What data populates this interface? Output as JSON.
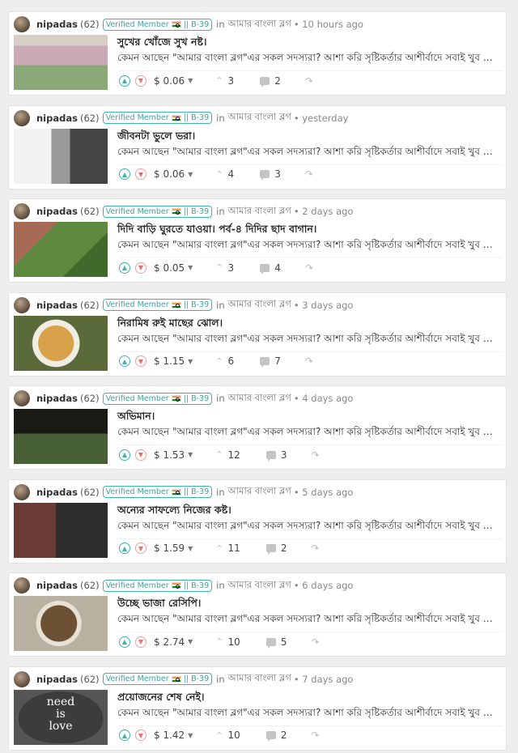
{
  "posts": [
    {
      "author": "nipadas",
      "rep": "(62)",
      "badge": "Verified Member",
      "badge_suffix": "|| B-39",
      "cat_prefix": "in",
      "category": "আমার বাংলা ব্লগ",
      "time": "• 10 hours ago",
      "title": "সুখের খোঁজে সুখ নষ্ট।",
      "excerpt": "কেমন আছেন \"আমার বাংলা ব্লগ\"এর সকল সদস্যরা? আশা করি সৃষ্টিকর্তার আশীর্বাদে সবাই খুব ভালো আছেন।",
      "payout": "$ 0.06",
      "votes": "3",
      "comments": "2"
    },
    {
      "author": "nipadas",
      "rep": "(62)",
      "badge": "Verified Member",
      "badge_suffix": "|| B-39",
      "cat_prefix": "in",
      "category": "আমার বাংলা ব্লগ",
      "time": "• yesterday",
      "title": "জীবনটা ভুলে ভরা।",
      "excerpt": "কেমন আছেন \"আমার বাংলা ব্লগ\"এর সকল সদস্যরা? আশা করি সৃষ্টিকর্তার আশীর্বাদে সবাই খুব ভালো আছেন।",
      "payout": "$ 0.06",
      "votes": "4",
      "comments": "3"
    },
    {
      "author": "nipadas",
      "rep": "(62)",
      "badge": "Verified Member",
      "badge_suffix": "|| B-39",
      "cat_prefix": "in",
      "category": "আমার বাংলা ব্লগ",
      "time": "• 2 days ago",
      "title": "দিদি বাড়ি ঘুরতে যাওয়া। পর্ব-৪ দিদির ছাদ বাগান।",
      "excerpt": "কেমন আছেন \"আমার বাংলা ব্লগ\"এর সকল সদস্যরা? আশা করি সৃষ্টিকর্তার আশীর্বাদে সবাই খুব ভালো আছেন।",
      "payout": "$ 0.05",
      "votes": "3",
      "comments": "4"
    },
    {
      "author": "nipadas",
      "rep": "(62)",
      "badge": "Verified Member",
      "badge_suffix": "|| B-39",
      "cat_prefix": "in",
      "category": "আমার বাংলা ব্লগ",
      "time": "• 3 days ago",
      "title": "নিরামিষ রুই মাছের ঝোল।",
      "excerpt": "কেমন আছেন \"আমার বাংলা ব্লগ\"এর সকল সদস্যরা? আশা করি সৃষ্টিকর্তার আশীর্বাদে সবাই খুব ভালো আছেন।",
      "payout": "$ 1.15",
      "votes": "6",
      "comments": "7"
    },
    {
      "author": "nipadas",
      "rep": "(62)",
      "badge": "Verified Member",
      "badge_suffix": "|| B-39",
      "cat_prefix": "in",
      "category": "আমার বাংলা ব্লগ",
      "time": "• 4 days ago",
      "title": "অভিমান।",
      "excerpt": "কেমন আছেন \"আমার বাংলা ব্লগ\"এর সকল সদস্যরা? আশা করি সৃষ্টিকর্তার আশীর্বাদে সবাই খুব ভালো আছেন।",
      "payout": "$ 1.53",
      "votes": "12",
      "comments": "3"
    },
    {
      "author": "nipadas",
      "rep": "(62)",
      "badge": "Verified Member",
      "badge_suffix": "|| B-39",
      "cat_prefix": "in",
      "category": "আমার বাংলা ব্লগ",
      "time": "• 5 days ago",
      "title": "অন্যের সাফল্যে নিজের কষ্ট।",
      "excerpt": "কেমন আছেন \"আমার বাংলা ব্লগ\"এর সকল সদস্যরা? আশা করি সৃষ্টিকর্তার আশীর্বাদে সবাই খুব ভালো আছেন।",
      "payout": "$ 1.59",
      "votes": "11",
      "comments": "2"
    },
    {
      "author": "nipadas",
      "rep": "(62)",
      "badge": "Verified Member",
      "badge_suffix": "|| B-39",
      "cat_prefix": "in",
      "category": "আমার বাংলা ব্লগ",
      "time": "• 6 days ago",
      "title": "উচ্ছে ভাজা রেসিপি।",
      "excerpt": "কেমন আছেন \"আমার বাংলা ব্লগ\"এর সকল সদস্যরা? আশা করি সৃষ্টিকর্তার আশীর্বাদে সবাই খুব ভালো আছেন।",
      "payout": "$ 2.74",
      "votes": "10",
      "comments": "5"
    },
    {
      "author": "nipadas",
      "rep": "(62)",
      "badge": "Verified Member",
      "badge_suffix": "|| B-39",
      "cat_prefix": "in",
      "category": "আমার বাংলা ব্লগ",
      "time": "• 7 days ago",
      "title": "প্রয়োজনের শেষ নেই।",
      "excerpt": "কেমন আছেন \"আমার বাংলা ব্লগ\"এর সকল সদস্যরা? আশা করি সৃষ্টিকর্তার আশীর্বাদে সবাই খুব ভালো আছেন।",
      "payout": "$ 1.42",
      "votes": "10",
      "comments": "2",
      "thumb_text": [
        "need",
        "is",
        "love"
      ]
    }
  ],
  "icons": {
    "upvote": "chevron-up-icon",
    "downvote": "chevron-down-icon",
    "votes": "caret-up-icon",
    "comments": "comments-icon",
    "share": "resteem-icon",
    "flag": "india-flag-icon"
  },
  "colors": {
    "accent": "#3fb3ad",
    "downvote": "#e07070",
    "background": "#eeeeee"
  }
}
